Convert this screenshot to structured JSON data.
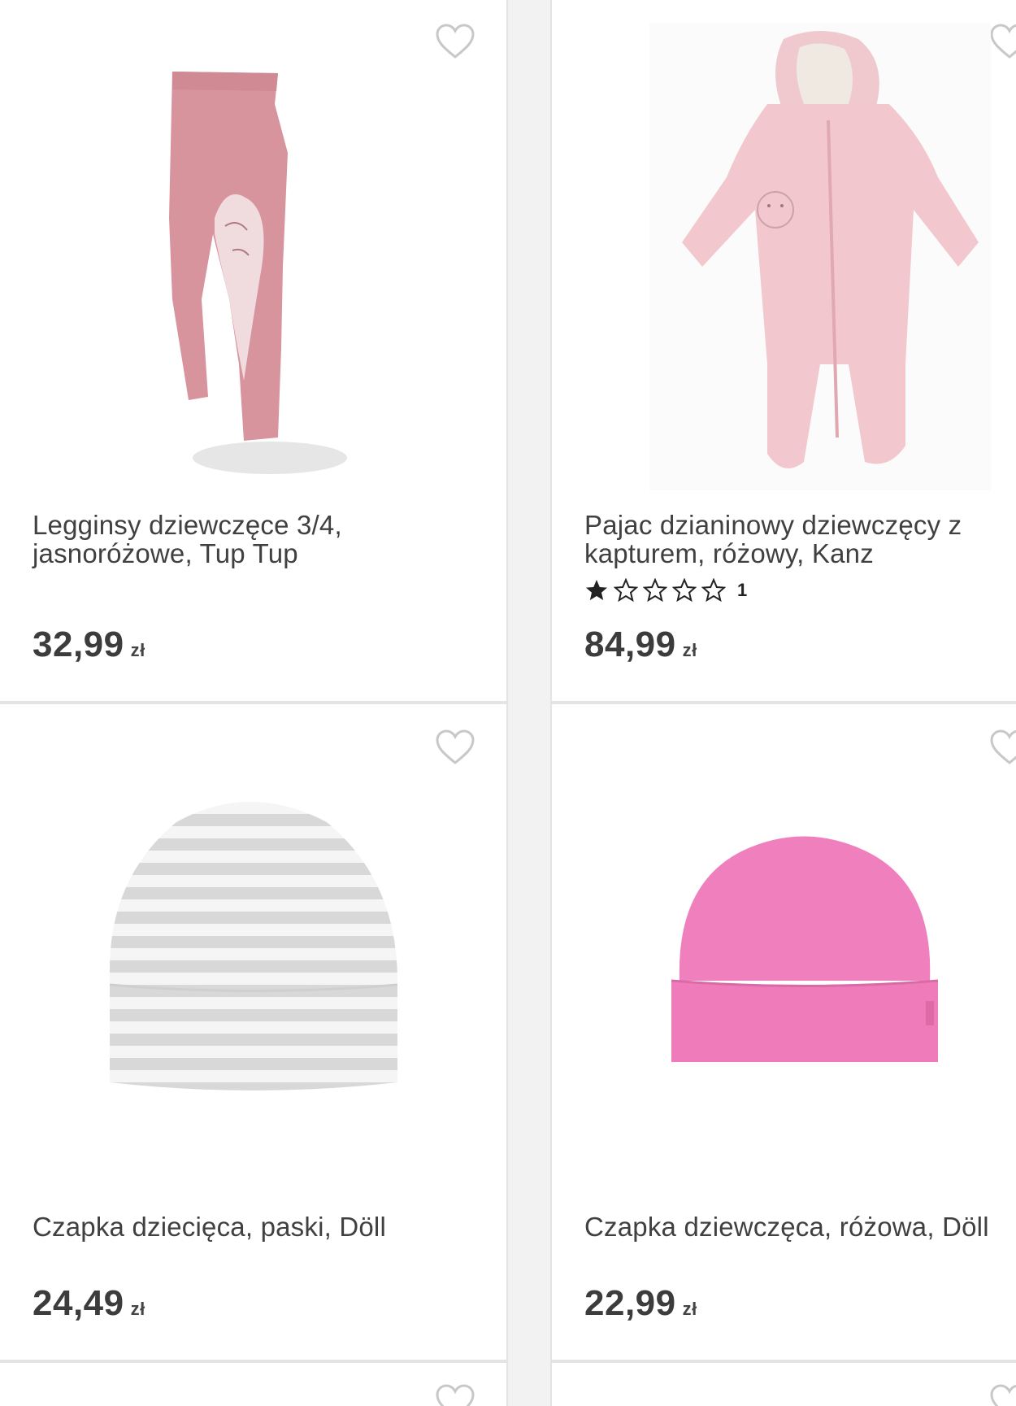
{
  "products": [
    {
      "title_line1": "Legginsy dziewczęce 3/4,",
      "title_line2": "jasnoróżowe, Tup Tup",
      "price": "32,99",
      "currency": "zł",
      "image": "pink-leggings-image"
    },
    {
      "title_line1": "Pajac dzianinowy dziewczęcy z",
      "title_line2": "kapturem, różowy, Kanz",
      "price": "84,99",
      "currency": "zł",
      "rating_stars": 1,
      "rating_max": 5,
      "rating_count": "1",
      "image": "pink-onesie-image"
    },
    {
      "title_line1": "Czapka dziecięca, paski, Döll",
      "price": "24,49",
      "currency": "zł",
      "image": "striped-hat-image"
    },
    {
      "title_line1": "Czapka dziewczęca, różowa, Döll",
      "price": "22,99",
      "currency": "zł",
      "image": "pink-hat-image"
    }
  ],
  "colors": {
    "heart_outline": "#c8c8c8",
    "text": "#404040",
    "card_border": "#e4e4e4"
  },
  "icons": {
    "wishlist": "heart-outline-icon",
    "rating_filled": "star-filled-icon",
    "rating_empty": "star-outline-icon"
  }
}
